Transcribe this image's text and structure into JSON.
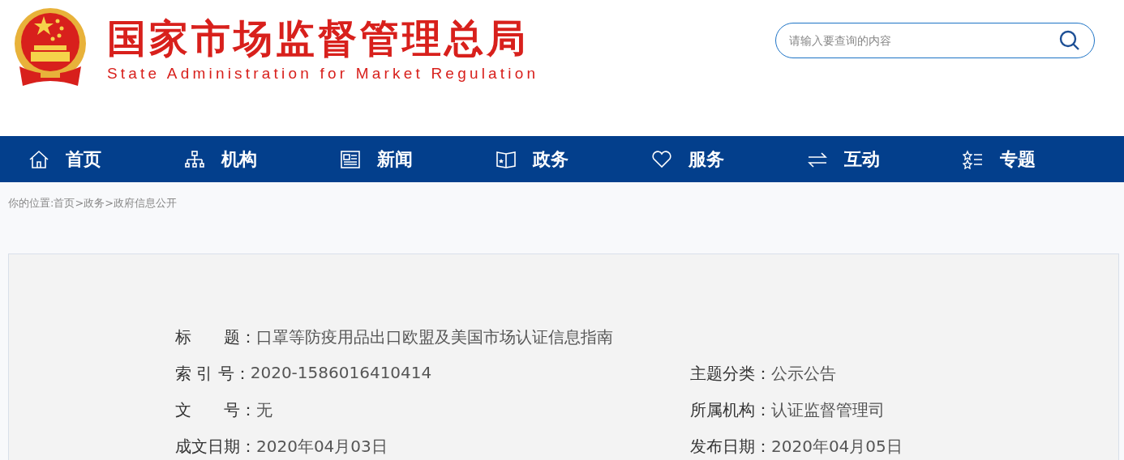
{
  "header": {
    "title": "国家市场监督管理总局",
    "subtitle": "State Administration for Market Regulation",
    "search": {
      "placeholder": "请输入要查询的内容"
    }
  },
  "nav": [
    {
      "label": "首页"
    },
    {
      "label": "机构"
    },
    {
      "label": "新闻"
    },
    {
      "label": "政务"
    },
    {
      "label": "服务"
    },
    {
      "label": "互动"
    },
    {
      "label": "专题"
    }
  ],
  "breadcrumb": [
    "你的位置:",
    "首页",
    ">",
    "政务",
    ">",
    "政府信息公开"
  ],
  "meta": [
    {
      "left": {
        "label": "标　　题：",
        "value": "口罩等防疫用品出口欧盟及美国市场认证信息指南"
      }
    },
    {
      "left": {
        "label": "索 引 号：",
        "value": "2020-1586016410414"
      },
      "right": {
        "label": "主题分类：",
        "value": "公示公告"
      }
    },
    {
      "left": {
        "label": "文　　号：",
        "value": "无"
      },
      "right": {
        "label": "所属机构：",
        "value": "认证监督管理司"
      }
    },
    {
      "left": {
        "label": "成文日期：",
        "value": "2020年04月03日"
      },
      "right": {
        "label": "发布日期：",
        "value": "2020年04月05日"
      }
    }
  ]
}
